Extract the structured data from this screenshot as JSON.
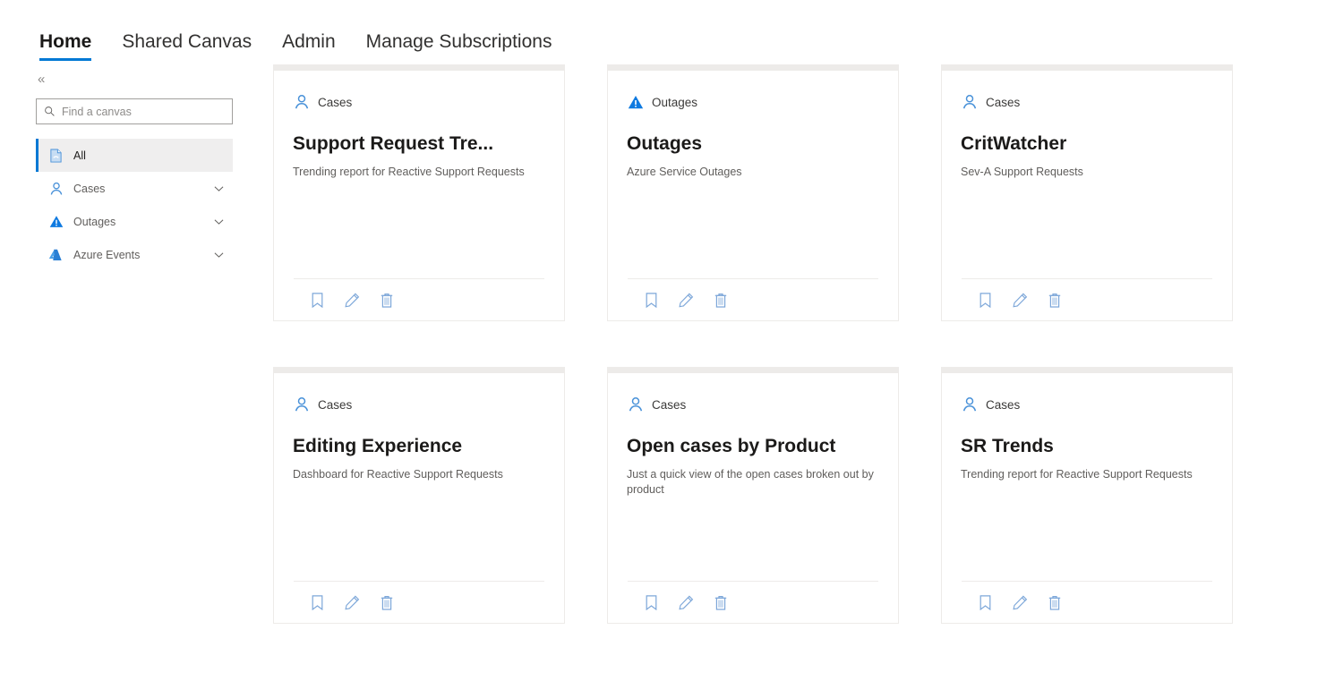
{
  "nav": {
    "tabs": [
      {
        "label": "Home",
        "active": true
      },
      {
        "label": "Shared Canvas",
        "active": false
      },
      {
        "label": "Admin",
        "active": false
      },
      {
        "label": "Manage Subscriptions",
        "active": false
      }
    ]
  },
  "sidebar": {
    "collapse_glyph": "«",
    "search": {
      "placeholder": "Find a canvas",
      "value": "",
      "icon": "search-icon"
    },
    "items": [
      {
        "label": "All",
        "icon": "document-icon",
        "selected": true,
        "expandable": false
      },
      {
        "label": "Cases",
        "icon": "person-icon",
        "selected": false,
        "expandable": true
      },
      {
        "label": "Outages",
        "icon": "warning-triangle-icon",
        "selected": false,
        "expandable": true
      },
      {
        "label": "Azure Events",
        "icon": "azure-logo-icon",
        "selected": false,
        "expandable": true
      }
    ]
  },
  "colors": {
    "accent": "#0078d4",
    "icon_blue": "#7da7d9",
    "card_border": "#edebe9",
    "selected_bg": "#efeeee"
  },
  "card_actions": [
    {
      "name": "bookmark-icon",
      "label": "Bookmark"
    },
    {
      "name": "edit-icon",
      "label": "Edit"
    },
    {
      "name": "delete-icon",
      "label": "Delete"
    }
  ],
  "cards": [
    {
      "category": "Cases",
      "category_icon": "person-icon",
      "title": "Support Request Tre...",
      "description": "Trending report for Reactive Support Requests"
    },
    {
      "category": "Outages",
      "category_icon": "warning-triangle-icon",
      "title": "Outages",
      "description": "Azure Service Outages"
    },
    {
      "category": "Cases",
      "category_icon": "person-icon",
      "title": "CritWatcher",
      "description": "Sev-A Support Requests"
    },
    {
      "category": "Cases",
      "category_icon": "person-icon",
      "title": "Editing Experience",
      "description": "Dashboard for Reactive Support Requests"
    },
    {
      "category": "Cases",
      "category_icon": "person-icon",
      "title": "Open cases by Product",
      "description": "Just a quick view of the open cases broken out by product"
    },
    {
      "category": "Cases",
      "category_icon": "person-icon",
      "title": "SR Trends",
      "description": "Trending report for Reactive Support Requests"
    }
  ]
}
